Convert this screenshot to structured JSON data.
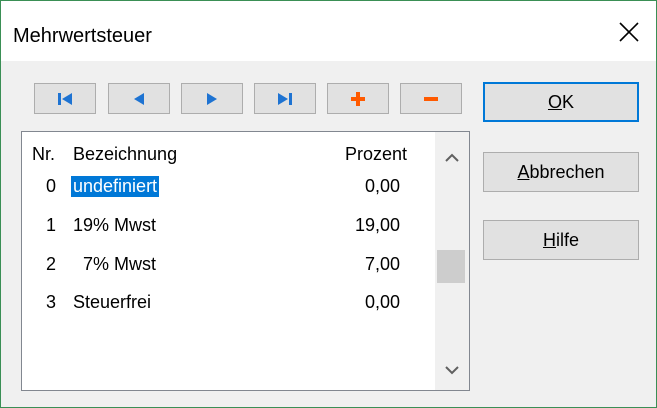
{
  "window": {
    "title": "Mehrwertsteuer"
  },
  "nav": {
    "first_icon": "first-record-icon",
    "prev_icon": "previous-record-icon",
    "next_icon": "next-record-icon",
    "last_icon": "last-record-icon",
    "add_icon": "plus-icon",
    "delete_icon": "minus-icon"
  },
  "buttons": {
    "ok": {
      "mnemonic": "O",
      "rest": "K"
    },
    "cancel": {
      "mnemonic": "A",
      "rest": "bbrechen"
    },
    "help": {
      "mnemonic": "H",
      "rest": "ilfe"
    }
  },
  "table": {
    "headers": {
      "nr": "Nr.",
      "name": "Bezeichnung",
      "pct": "Prozent"
    },
    "rows": [
      {
        "nr": "0",
        "name": "undefiniert",
        "pct": "0,00"
      },
      {
        "nr": "1",
        "name": "19% Mwst",
        "pct": "19,00"
      },
      {
        "nr": "2",
        "name": "  7% Mwst",
        "pct": "7,00"
      },
      {
        "nr": "3",
        "name": "Steuerfrei",
        "pct": "0,00"
      }
    ],
    "selected_index": 0
  },
  "colors": {
    "accent": "#0078d7",
    "nav_blue": "#1e73d2",
    "nav_orange": "#ff5a00"
  }
}
